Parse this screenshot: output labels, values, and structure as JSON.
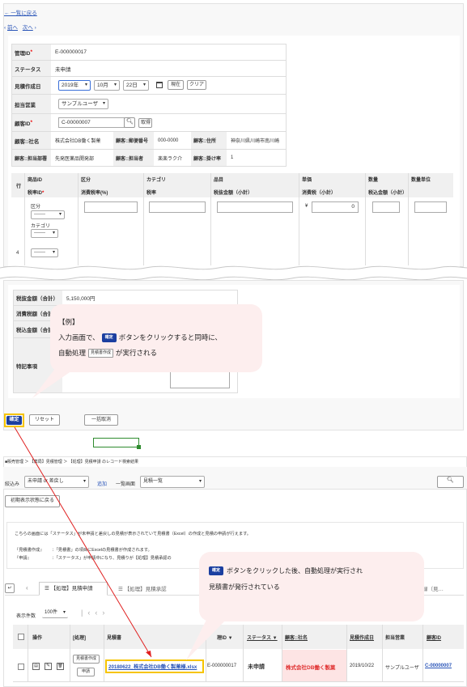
{
  "nav": {
    "back": "← 一覧に戻る",
    "prev": "前へ",
    "next": "次へ"
  },
  "form": {
    "id_label": "管理ID",
    "id_value": "E-000000017",
    "status_label": "ステータス",
    "status_value": "未申請",
    "date_label": "見積作成日",
    "year": "2019年",
    "month": "10月",
    "day": "22日",
    "today_btn": "現在",
    "clear_btn": "クリア",
    "sales_label": "担当営業",
    "sales_value": "サンプルユーザ",
    "customer_label": "顧客ID",
    "customer_value": "C-00000007",
    "fetch_btn": "取得",
    "company_label": "顧客::社名",
    "company_value": "株式会社DB働く製菓",
    "zip_label": "顧客::郵便番号",
    "zip_value": "000-0000",
    "addr_label": "顧客::住所",
    "addr_value": "神奈川県川崎市南川崎",
    "dept_label": "顧客::担当部署",
    "dept_value": "先発医薬品開発部",
    "person_label": "顧客::担当者",
    "person_value": "楽楽ラク介",
    "rate_label": "顧客::掛け率",
    "rate_value": "1"
  },
  "items": {
    "row_header": "行",
    "headers_top": [
      "商品ID",
      "区分",
      "カテゴリ",
      "品目",
      "単価",
      "数量",
      "数量単位"
    ],
    "headers_bottom": [
      "税率ID",
      "消費税率(%)",
      "税率",
      "税抜金額（小計）",
      "消費税（小計）",
      "税込金額（小計）"
    ],
    "kubun_label": "区分",
    "kubun_value": "-------",
    "category_label": "カテゴリ",
    "category_value": "-------",
    "row_num": "4",
    "row_select": "-------",
    "yen": "¥",
    "price_value": "0"
  },
  "totals": {
    "taxfree_label": "税抜金額（合計）",
    "taxfree_value": "5,150,000円",
    "tax_label": "消費税額（合計）",
    "taxin_label": "税込金額（合計）",
    "note_label": "特記事項"
  },
  "actions": {
    "confirm": "確定",
    "reset": "リセット",
    "cancel": "一括取消"
  },
  "bubble1": {
    "line1": "【例】",
    "line2a": "入力画面で、",
    "chip": "確定",
    "line2b": "ボタンをクリックすると同時に、",
    "line3a": "自動処理",
    "chip2": "見積書作成",
    "line3b": "が実行される"
  },
  "list": {
    "breadcrumb": "■販売管理 ＞ 【薬局】見積管理 ＞ 【処理】見積申請 のレコード検索結果",
    "filter_label": "絞込み",
    "filter_value": "未申請 or 差戻し",
    "add_link": "追加",
    "view_label": "一覧画面",
    "view_value": "見積一覧",
    "init_btn": "初期表示状態に戻る",
    "desc1": "こちらの画面には「ステータス」が未申請と差戻しの見積が表示されていて見積書（Excel）の作成と見積の申請が行えます。",
    "desc2k": "『見積書作成』",
    "desc2v": "：「見積書」の項目にExcelの見積書が作成されます。",
    "desc3k": "『申請』",
    "desc3v": "：「ステータス」が申請中になり、見積りが【処理】見積承認の",
    "tab_active": "【処理】見積申請",
    "tab2": "【処理】見積承認",
    "tab_last": "録（見…",
    "count_label": "表示件数",
    "count_value": "100件",
    "headers": [
      "操作",
      "[処理]",
      "見積書",
      "理ID",
      "ステータス",
      "顧客::社名",
      "見積作成日",
      "担当営業",
      "顧客ID"
    ],
    "row": {
      "btn1": "見積書作成",
      "btn2": "申請",
      "file": "20180622_株式会社DB働く製菓様.xlsx",
      "id": "E-000000017",
      "status": "未申請",
      "company": "株式会社DB働く製菓",
      "date": "2019/10/22",
      "sales": "サンプルユーザ",
      "customer": "C-00000007"
    }
  },
  "bubble2": {
    "chip": "確定",
    "line1": "ボタンをクリックした後、自動処理が実行され",
    "line2": "見積書が発行されている"
  },
  "colors": {
    "accent": "#1b3fa0",
    "link": "#2a55b8",
    "bubble": "#fdeeee",
    "highlight": "#f6c400",
    "red_arrow": "#e02020",
    "required": "#e00000"
  }
}
